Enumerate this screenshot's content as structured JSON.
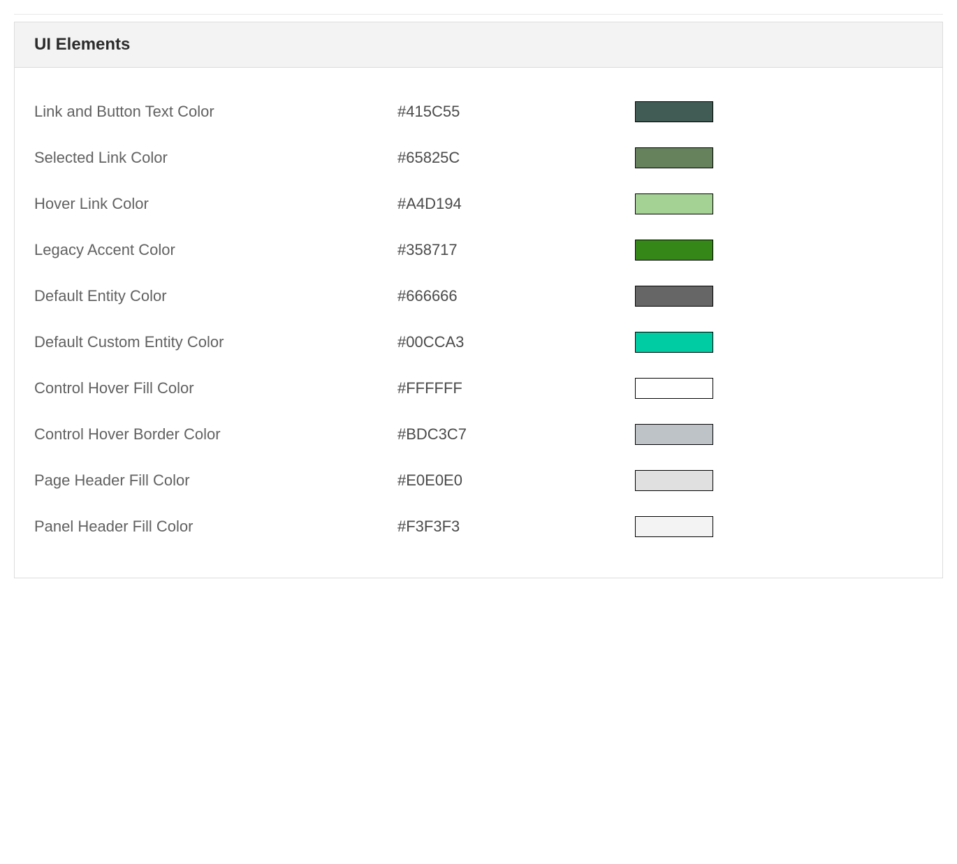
{
  "panel": {
    "title": "UI Elements",
    "rows": [
      {
        "label": "Link and Button Text Color",
        "value": "#415C55",
        "swatch": "#415C55"
      },
      {
        "label": "Selected Link Color",
        "value": "#65825C",
        "swatch": "#65825C"
      },
      {
        "label": "Hover Link Color",
        "value": "#A4D194",
        "swatch": "#A4D194"
      },
      {
        "label": "Legacy Accent Color",
        "value": "#358717",
        "swatch": "#358717"
      },
      {
        "label": "Default Entity Color",
        "value": "#666666",
        "swatch": "#666666"
      },
      {
        "label": "Default Custom Entity Color",
        "value": "#00CCA3",
        "swatch": "#00CCA3"
      },
      {
        "label": "Control Hover Fill Color",
        "value": "#FFFFFF",
        "swatch": "#FFFFFF"
      },
      {
        "label": "Control Hover Border Color",
        "value": "#BDC3C7",
        "swatch": "#BDC3C7"
      },
      {
        "label": "Page Header Fill Color",
        "value": "#E0E0E0",
        "swatch": "#E0E0E0"
      },
      {
        "label": "Panel Header Fill Color",
        "value": "#F3F3F3",
        "swatch": "#F3F3F3"
      }
    ]
  }
}
